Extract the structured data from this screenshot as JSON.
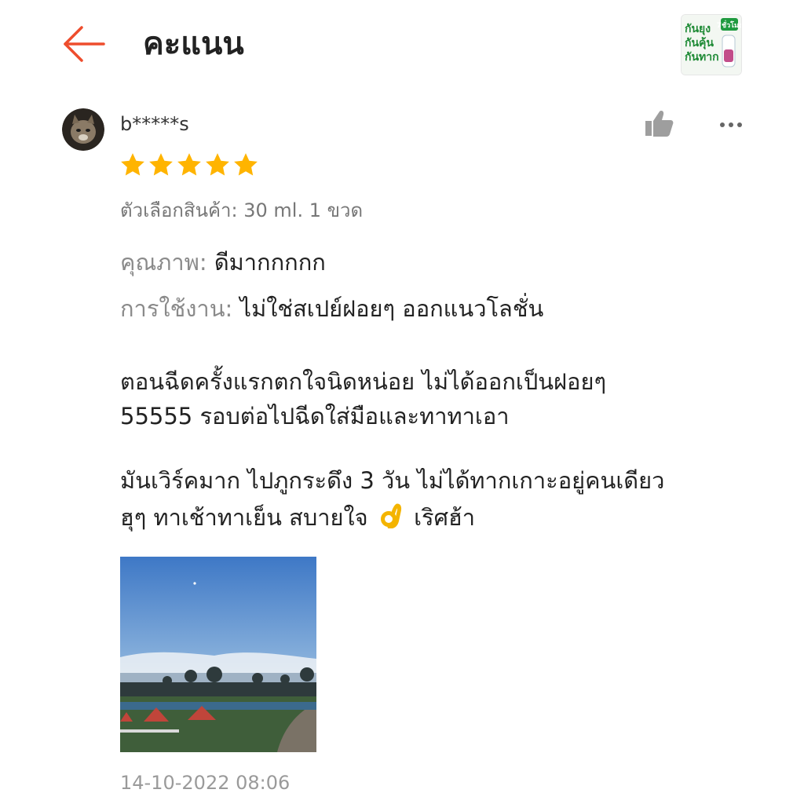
{
  "header": {
    "title": "คะแนน",
    "back_icon": "arrow-left-icon",
    "accent_color": "#ee4d2d",
    "product_thumbnail_text": [
      "กันยุง",
      "กันคุ้น",
      "กันทาก",
      "7ชั่วโมง"
    ]
  },
  "review": {
    "username": "b*****s",
    "rating": 5,
    "rating_max": 5,
    "star_color": "#ffb400",
    "variant": {
      "label": "ตัวเลือกสินค้า:",
      "value": "30 ml. 1 ขวด"
    },
    "quality": {
      "label": "คุณภาพ:",
      "value": "ดีมากกกกก"
    },
    "usage": {
      "label": "การใช้งาน:",
      "value": "ไม่ใช่สเปย์ฝอยๆ ออกแนวโลชั่น"
    },
    "paragraph1": {
      "line1": "ตอนฉีดครั้งแรกตกใจนิดหน่อย ไม่ได้ออกเป็นฝอยๆ",
      "line2": "55555 รอบต่อไปฉีดใส่มือและทาทาเอา"
    },
    "paragraph2": {
      "line1": "มันเวิร์คมาก ไปภูกระดึง 3 วัน ไม่ได้ทากเกาะอยู่คนเดียว",
      "line2_before": "ฮุๆ ทาเช้าทาเย็น สบายใจ",
      "line2_emoji": "ok-hand-emoji",
      "line2_after": "เริศฮ้า"
    },
    "photo_icon": "campsite-photo",
    "timestamp": "14-10-2022 08:06",
    "like_icon": "thumbs-up-icon",
    "more_icon": "more-dots-icon"
  }
}
